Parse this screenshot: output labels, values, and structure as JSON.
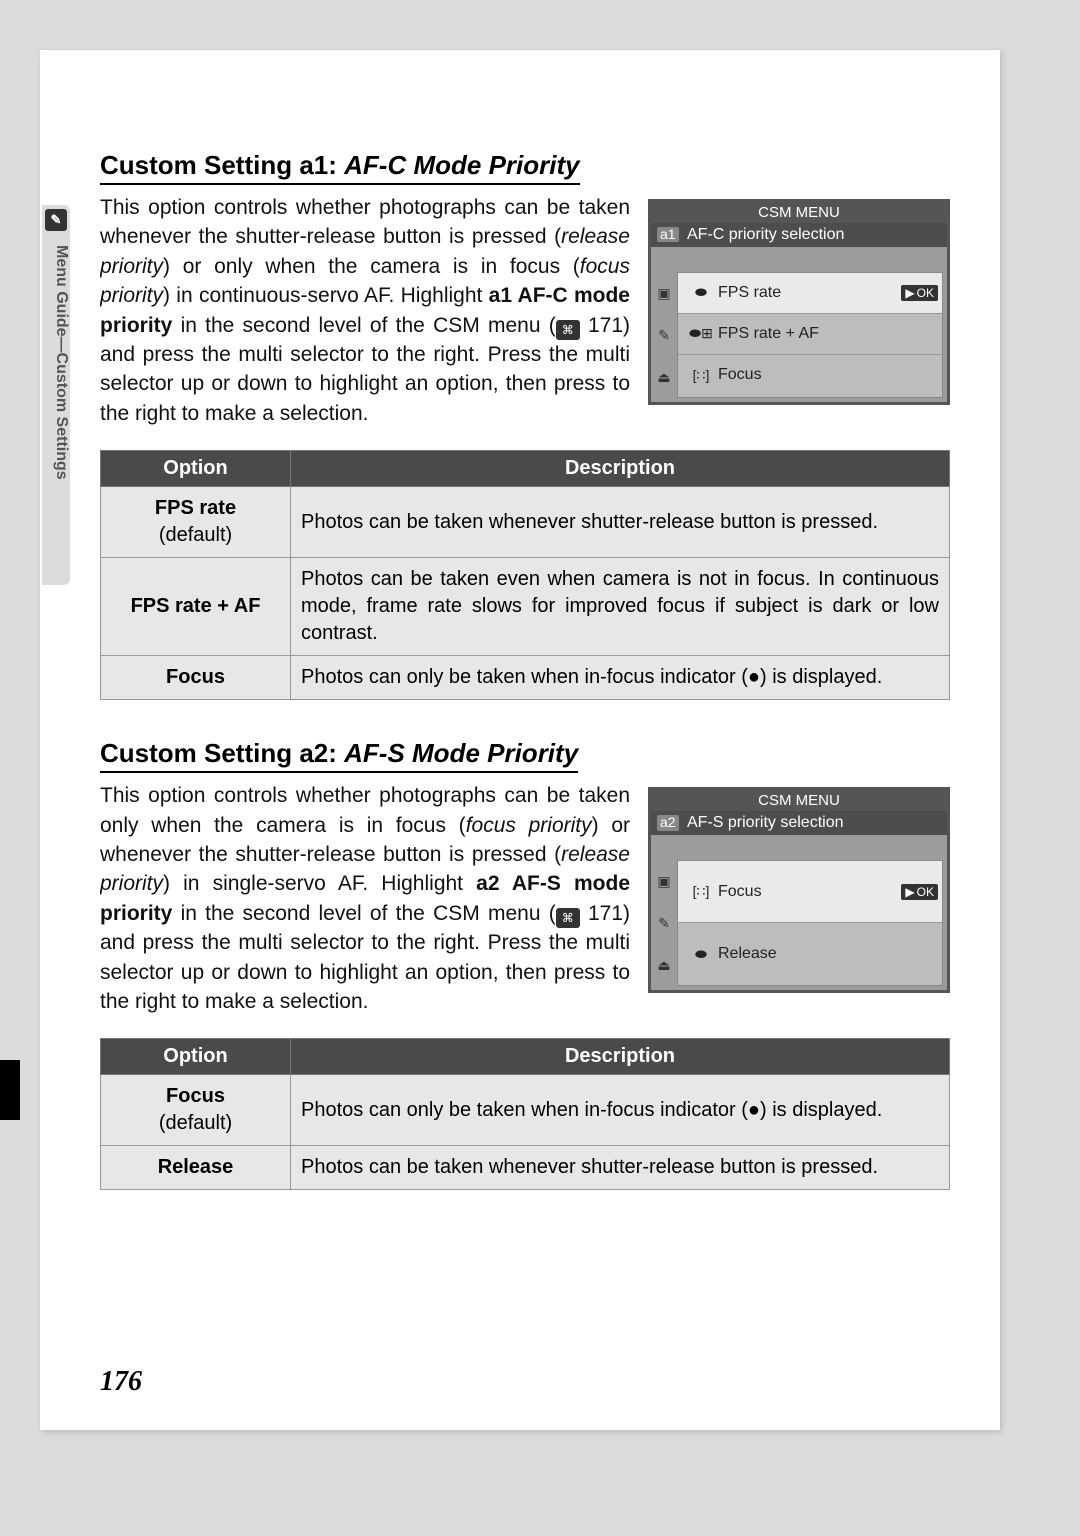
{
  "side_tab": {
    "label": "Menu Guide—Custom Settings"
  },
  "page_number": "176",
  "sections": [
    {
      "heading_prefix": "Custom Setting a1: ",
      "heading_italic": "AF-C Mode Priority",
      "body_html": "This option controls whether photographs can be taken whenever the shutter-release button is pressed (<span class='italic'>release priority</span>) or only when the camera is in focus (<span class='italic'>focus priority</span>) in continuous-servo AF. Highlight <span class='bold'>a1 AF-C mode priority</span> in the second level of the CSM menu (<span class='page-ref-icon'>⌘</span> 171) and press the multi selector to the right.  Press the multi selector up or down to highlight an option, then press to the right to make a selection.",
      "lcd": {
        "title": "CSM MENU",
        "code": "a1",
        "subtitle": "AF-C priority selection",
        "selected_index": 0,
        "rows": [
          {
            "icon": "⬬",
            "label": "FPS rate"
          },
          {
            "icon": "⬬⊞",
            "label": "FPS rate + AF"
          },
          {
            "icon": "[∷]",
            "label": "Focus"
          }
        ],
        "ok_label": "OK"
      },
      "table": {
        "headers": [
          "Option",
          "Description"
        ],
        "rows": [
          {
            "option": "FPS rate",
            "sub": "(default)",
            "desc": "Photos can be taken whenever shutter-release button is pressed."
          },
          {
            "option": "FPS rate + AF",
            "sub": "",
            "desc": "Photos can be taken even when camera is not in focus.  In continuous mode, frame rate slows for improved focus if subject is dark or low contrast."
          },
          {
            "option": "Focus",
            "sub": "",
            "desc": "Photos can only be taken when in-focus indicator (●) is displayed."
          }
        ]
      }
    },
    {
      "heading_prefix": "Custom Setting a2: ",
      "heading_italic": "AF-S Mode Priority",
      "body_html": "This option controls whether photographs can be taken only when the camera is in focus (<span class='italic'>focus priority</span>) or whenever the shutter-release button is pressed (<span class='italic'>release priority</span>) in single-servo AF.  Highlight <span class='bold'>a2 AF-S mode priority</span> in the second level of the CSM menu (<span class='page-ref-icon'>⌘</span> 171) and press the multi selector to the right.  Press the multi selector up or down to highlight an option, then press to the right to make a selection.",
      "lcd": {
        "title": "CSM MENU",
        "code": "a2",
        "subtitle": "AF-S priority selection",
        "selected_index": 0,
        "rows": [
          {
            "icon": "[∷]",
            "label": "Focus"
          },
          {
            "icon": "⬬",
            "label": "Release"
          }
        ],
        "ok_label": "OK"
      },
      "table": {
        "headers": [
          "Option",
          "Description"
        ],
        "rows": [
          {
            "option": "Focus",
            "sub": "(default)",
            "desc": "Photos can only be taken when in-focus indicator (●) is displayed."
          },
          {
            "option": "Release",
            "sub": "",
            "desc": "Photos can be taken whenever shutter-release button is pressed."
          }
        ]
      }
    }
  ]
}
